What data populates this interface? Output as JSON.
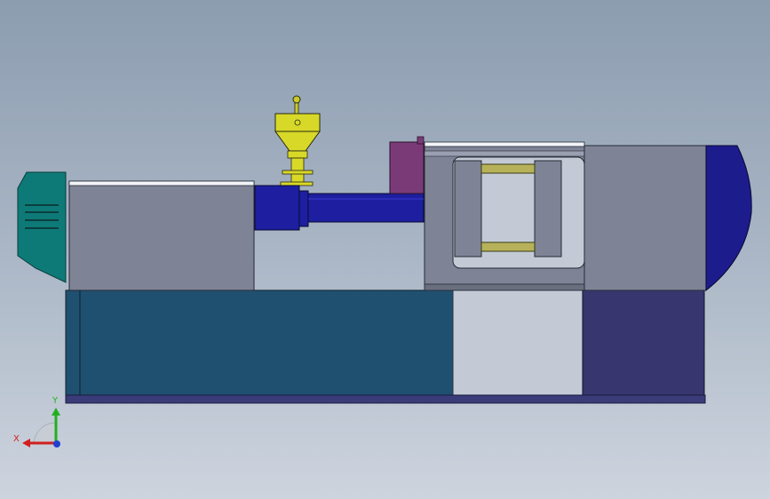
{
  "scene": {
    "background_top": "#8c9db0",
    "background_bottom": "#cdd4de",
    "model": {
      "name": "injection-molding-machine",
      "parts": [
        "motor-cover",
        "injection-unit-housing",
        "hopper",
        "barrel",
        "nozzle-block",
        "fixed-platen",
        "tie-bars",
        "moving-platen-frame",
        "clamp-cylinder-cap",
        "machine-base"
      ]
    },
    "colors": {
      "motor_cover": "#0e7a78",
      "housing": "#7e8496",
      "hopper": "#d8d829",
      "barrel": "#1d1fa0",
      "nozzle_block": "#7a3a78",
      "base_left": "#205070",
      "base_right": "#38366e",
      "clamp_cap": "#1c1c8c",
      "tie_bar": "#b7b25a"
    }
  },
  "triad": {
    "x_label": "X",
    "y_label": "Y",
    "x_color": "#d02020",
    "y_color": "#20b020",
    "z_color": "#2040d0"
  }
}
